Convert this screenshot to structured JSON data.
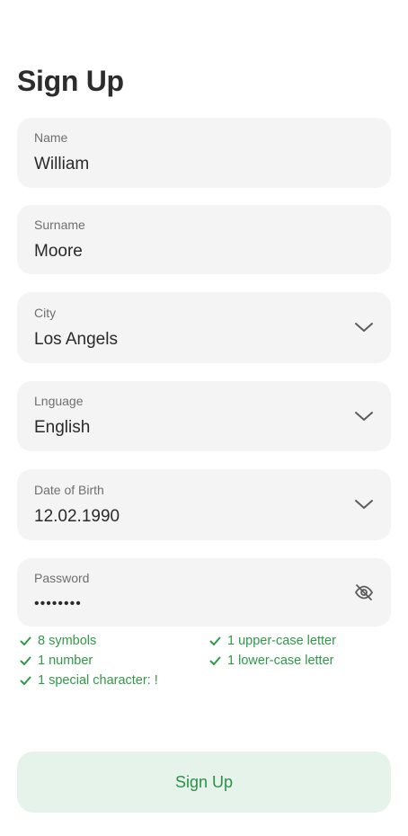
{
  "page": {
    "title": "Sign Up"
  },
  "fields": {
    "name": {
      "label": "Name",
      "value": "William"
    },
    "surname": {
      "label": "Surname",
      "value": "Moore"
    },
    "city": {
      "label": "City",
      "value": "Los Angels"
    },
    "language": {
      "label": "Lnguage",
      "value": "English"
    },
    "dob": {
      "label": "Date of Birth",
      "value": "12.02.1990"
    },
    "password": {
      "label": "Password",
      "value": "••••••••"
    }
  },
  "requirements": [
    "8 symbols",
    "1 upper-case letter",
    "1 number",
    "1 lower-case letter",
    "1 special character: !"
  ],
  "actions": {
    "submit_label": "Sign Up"
  },
  "colors": {
    "field_bg": "#f4f4f4",
    "success_green": "#2e9a47",
    "button_bg": "#e5f3ea",
    "button_text": "#2e8f48"
  },
  "icons": {
    "dropdown": "chevron-down-icon",
    "password_visibility": "eye-off-icon",
    "requirement_met": "check-icon"
  }
}
